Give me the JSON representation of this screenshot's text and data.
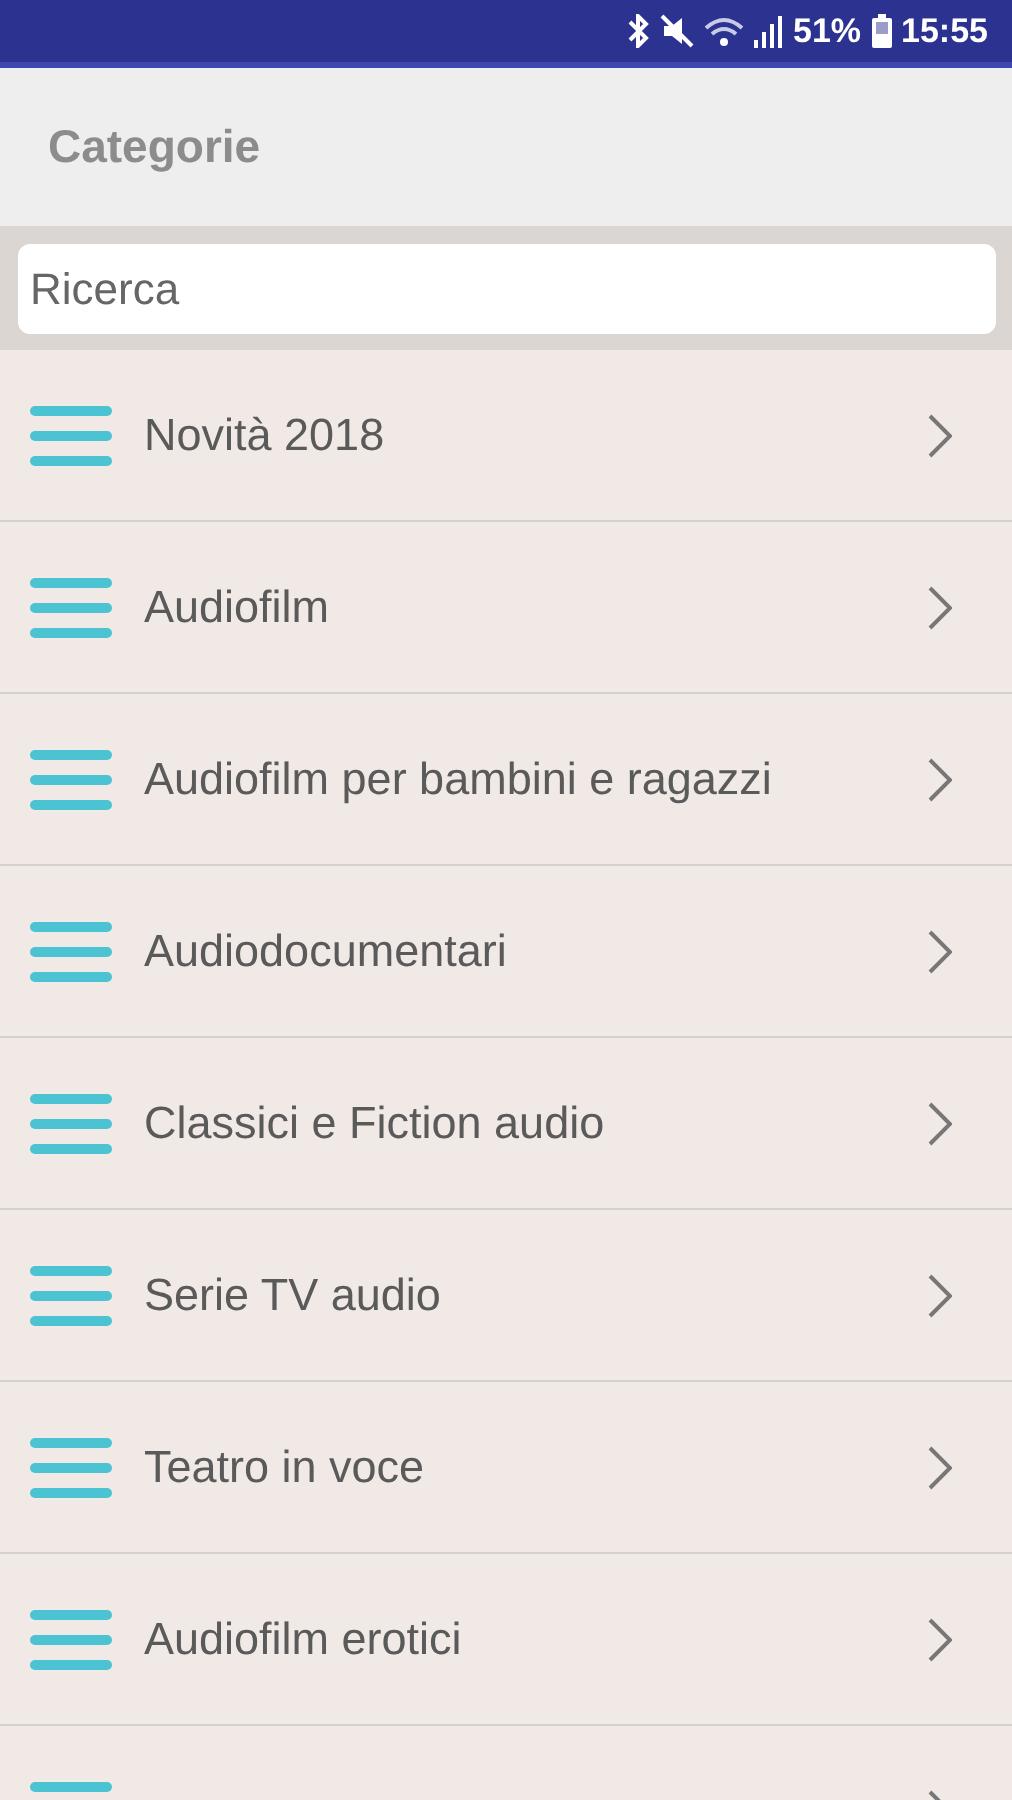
{
  "status_bar": {
    "battery_text": "51%",
    "time": "15:55"
  },
  "header": {
    "title": "Categorie"
  },
  "search": {
    "placeholder": "Ricerca"
  },
  "categories": [
    {
      "label": "Novità 2018"
    },
    {
      "label": "Audiofilm"
    },
    {
      "label": "Audiofilm per bambini e ragazzi"
    },
    {
      "label": "Audiodocumentari"
    },
    {
      "label": "Classici e Fiction audio"
    },
    {
      "label": "Serie TV audio"
    },
    {
      "label": "Teatro in voce"
    },
    {
      "label": "Audiofilm erotici"
    }
  ]
}
